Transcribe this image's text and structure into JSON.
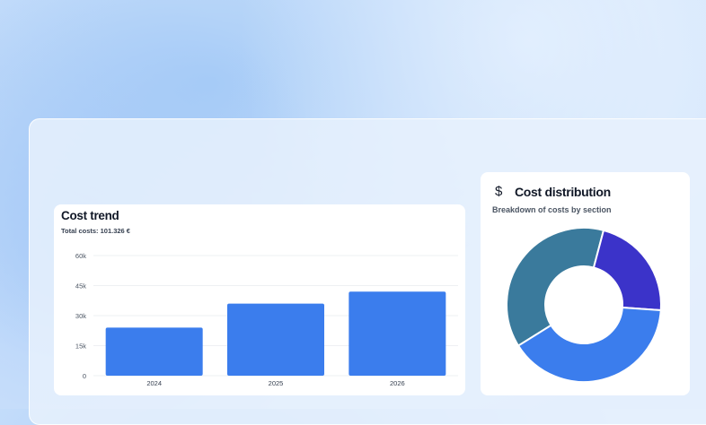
{
  "trend": {
    "title": "Cost trend",
    "total_label": "Total costs: 101.326 €"
  },
  "distribution": {
    "icon": "dollar-icon",
    "icon_glyph": "$",
    "title": "Cost distribution",
    "subtitle": "Breakdown of costs by section"
  },
  "chart_data": [
    {
      "type": "bar",
      "categories": [
        "2024",
        "2025",
        "2026"
      ],
      "values": [
        24000,
        36000,
        42000
      ],
      "yticks": [
        "0",
        "15k",
        "30k",
        "45k",
        "60k"
      ],
      "ylim": [
        0,
        60000
      ],
      "grid": true,
      "bar_color": "#3b7ded"
    },
    {
      "type": "pie",
      "donut": true,
      "slices": [
        {
          "value": 38,
          "color": "#3a7a9c"
        },
        {
          "value": 22,
          "color": "#3b33c9"
        },
        {
          "value": 40,
          "color": "#3b7ded"
        }
      ]
    }
  ]
}
